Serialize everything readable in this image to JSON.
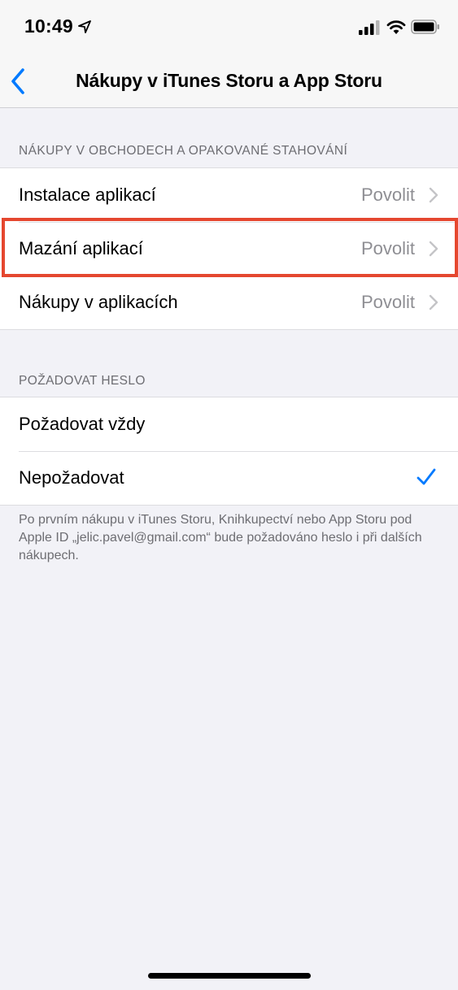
{
  "status_bar": {
    "time": "10:49"
  },
  "nav": {
    "title": "Nákupy v iTunes Storu a App Storu"
  },
  "section1": {
    "header": "NÁKUPY V OBCHODECH A OPAKOVANÉ STAHOVÁNÍ",
    "rows": [
      {
        "label": "Instalace aplikací",
        "value": "Povolit"
      },
      {
        "label": "Mazání aplikací",
        "value": "Povolit"
      },
      {
        "label": "Nákupy v aplikacích",
        "value": "Povolit"
      }
    ]
  },
  "section2": {
    "header": "POŽADOVAT HESLO",
    "rows": [
      {
        "label": "Požadovat vždy",
        "selected": false
      },
      {
        "label": "Nepožadovat",
        "selected": true
      }
    ],
    "footer": "Po prvním nákupu v iTunes Storu, Knihkupectví nebo App Storu pod Apple ID „jelic.pavel@gmail.com“ bude požadováno heslo i při dalších nákupech."
  },
  "colors": {
    "accent": "#007aff",
    "highlight": "#e5472f",
    "background": "#f2f2f7"
  },
  "icons": [
    "location-arrow-icon",
    "signal-icon",
    "wifi-icon",
    "battery-icon",
    "back-chevron-icon",
    "chevron-right-icon",
    "checkmark-icon"
  ]
}
